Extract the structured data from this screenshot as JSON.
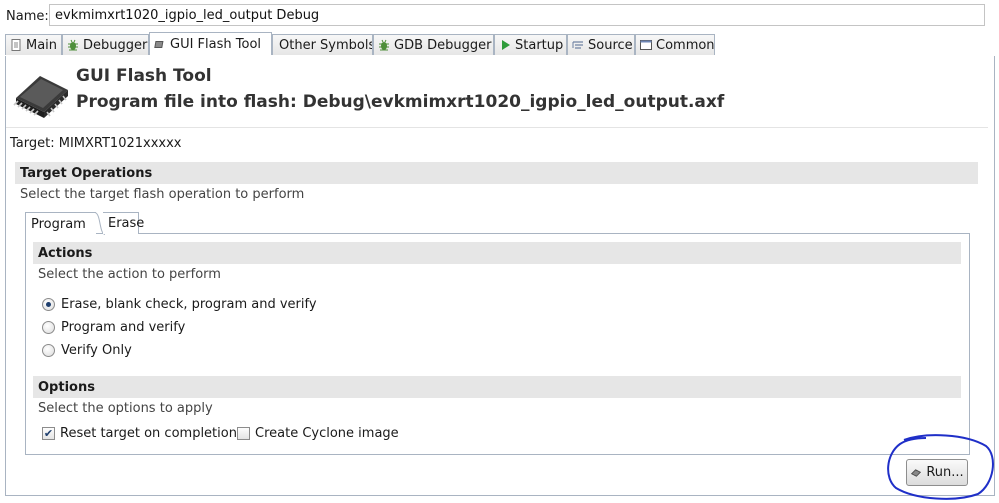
{
  "name_row": {
    "label": "Name:",
    "value": "evkmimxrt1020_igpio_led_output Debug"
  },
  "tabs": [
    {
      "label": "Main",
      "icon": "page-icon"
    },
    {
      "label": "Debugger",
      "icon": "bug-icon"
    },
    {
      "label": "GUI Flash Tool",
      "icon": "chip-icon"
    },
    {
      "label": "Other Symbols",
      "icon": "none"
    },
    {
      "label": "GDB Debugger",
      "icon": "bug-icon"
    },
    {
      "label": "Startup",
      "icon": "play-icon"
    },
    {
      "label": "Source",
      "icon": "source-icon"
    },
    {
      "label": "Common",
      "icon": "window-icon"
    }
  ],
  "active_tab": "GUI Flash Tool",
  "header": {
    "title": "GUI Flash Tool",
    "subtitle": "Program file into flash: Debug\\evkmimxrt1020_igpio_led_output.axf"
  },
  "target": "Target: MIMXRT1021xxxxx",
  "target_operations": {
    "title": "Target Operations",
    "description": "Select the target flash operation to perform",
    "tabs": [
      "Program",
      "Erase"
    ],
    "active_tab": "Program"
  },
  "actions": {
    "title": "Actions",
    "description": "Select the action to perform",
    "options": [
      {
        "label": "Erase, blank check, program and verify",
        "selected": true
      },
      {
        "label": "Program and verify",
        "selected": false
      },
      {
        "label": "Verify Only",
        "selected": false
      }
    ]
  },
  "options": {
    "title": "Options",
    "description": "Select the options to apply",
    "checkboxes": [
      {
        "label": "Reset target on completion",
        "checked": true
      },
      {
        "label": "Create Cyclone image",
        "checked": false
      }
    ]
  },
  "run_button": {
    "label": "Run..."
  },
  "colors": {
    "annotation_circle": "#1f2fc8",
    "section_bg": "#e6e6e6",
    "border": "#a9b4c2"
  }
}
